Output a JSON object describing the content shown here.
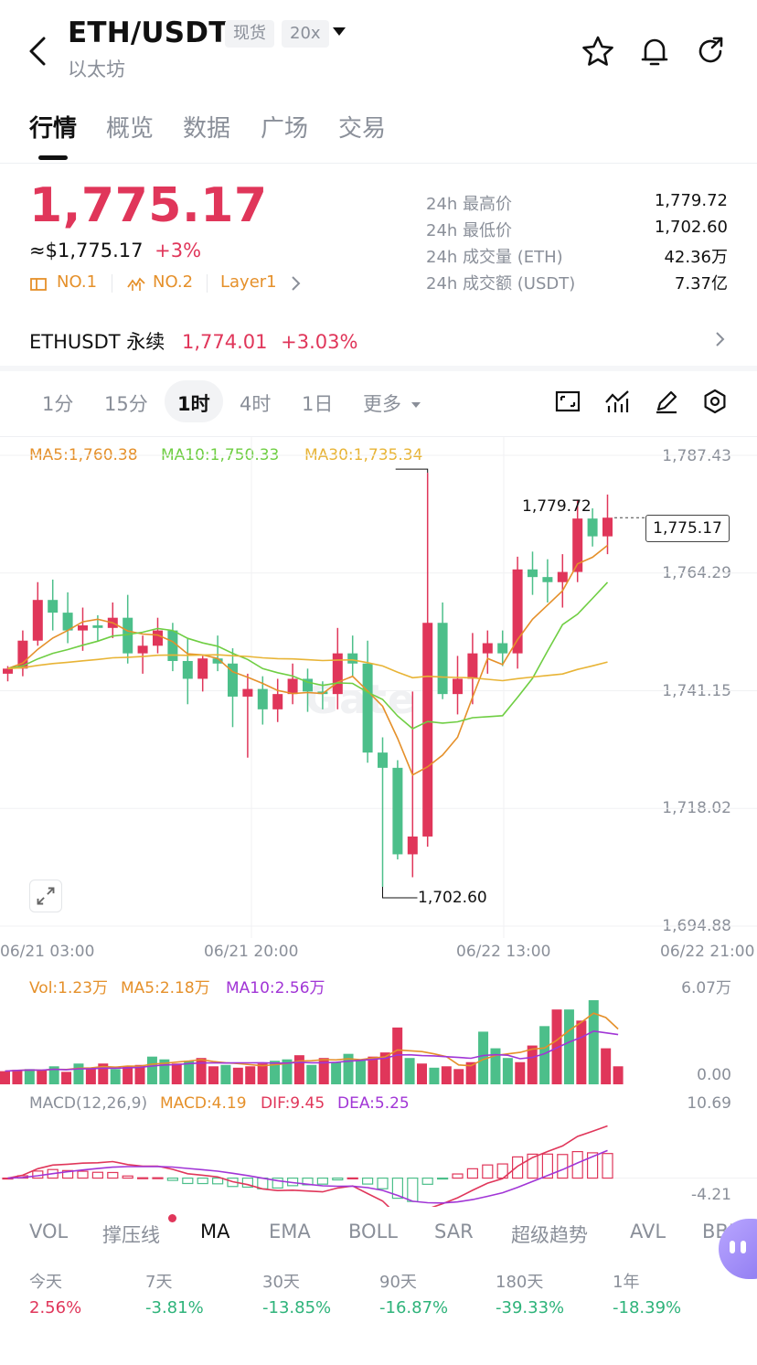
{
  "header": {
    "pair": "ETH/USDT",
    "tag_spot": "现货",
    "tag_leverage": "20x",
    "name": "以太坊",
    "icons": [
      "back-icon",
      "star-icon",
      "bell-icon",
      "share-icon"
    ]
  },
  "tabs": [
    "行情",
    "概览",
    "数据",
    "广场",
    "交易"
  ],
  "price": {
    "last": "1,775.17",
    "usd": "≈$1,775.17",
    "change": "+3%",
    "rank1": "NO.1",
    "rank2": "NO.2",
    "category": "Layer1"
  },
  "stats": [
    {
      "label": "24h 最高价",
      "value": "1,779.72"
    },
    {
      "label": "24h 最低价",
      "value": "1,702.60"
    },
    {
      "label": "24h 成交量 (ETH)",
      "value": "42.36万"
    },
    {
      "label": "24h 成交额 (USDT)",
      "value": "7.37亿"
    }
  ],
  "perp": {
    "name": "ETHUSDT 永续",
    "price": "1,774.01",
    "change": "+3.03%"
  },
  "intervals": [
    "1分",
    "15分",
    "1时",
    "4时",
    "1日",
    "更多"
  ],
  "intervals_active": "1时",
  "chart_tools": [
    "fullscreen-icon",
    "indicator-icon",
    "draw-icon",
    "settings-icon"
  ],
  "ma_legend": {
    "ma5": "MA5:1,760.38",
    "ma10": "MA10:1,750.33",
    "ma30": "MA30:1,735.34"
  },
  "watermark": "Gate",
  "chart_data": {
    "type": "candlestick",
    "y_labels": [
      "1,787.43",
      "1,764.29",
      "1,741.15",
      "1,718.02",
      "1,694.88"
    ],
    "ylim": [
      1694.88,
      1787.43
    ],
    "x_labels": [
      "06/21 03:00",
      "06/21 20:00",
      "06/22 13:00",
      "06/22 21:00"
    ],
    "current_price": "1,775.17",
    "high_annotation": "1,779.72",
    "low_annotation": "1,702.60",
    "candles": [
      [
        1744.5,
        1746.0,
        1743.0,
        1745.5
      ],
      [
        1745.5,
        1753.0,
        1744.0,
        1751.0
      ],
      [
        1751.0,
        1762.5,
        1750.0,
        1759.0
      ],
      [
        1759.0,
        1763.0,
        1753.0,
        1756.5
      ],
      [
        1756.5,
        1760.5,
        1750.5,
        1753.0
      ],
      [
        1753.0,
        1757.5,
        1749.0,
        1754.0
      ],
      [
        1754.0,
        1756.0,
        1751.0,
        1753.5
      ],
      [
        1753.5,
        1758.5,
        1751.5,
        1755.5
      ],
      [
        1755.5,
        1760.0,
        1746.5,
        1748.5
      ],
      [
        1748.5,
        1752.0,
        1744.5,
        1750.0
      ],
      [
        1750.0,
        1755.5,
        1748.5,
        1753.0
      ],
      [
        1753.0,
        1754.5,
        1745.0,
        1747.0
      ],
      [
        1747.0,
        1751.5,
        1738.5,
        1743.5
      ],
      [
        1743.5,
        1748.0,
        1741.0,
        1747.5
      ],
      [
        1747.5,
        1752.0,
        1745.0,
        1746.5
      ],
      [
        1746.5,
        1749.5,
        1734.0,
        1740.0
      ],
      [
        1740.0,
        1744.5,
        1728.0,
        1741.5
      ],
      [
        1741.5,
        1744.0,
        1734.5,
        1737.5
      ],
      [
        1737.5,
        1743.5,
        1735.0,
        1740.5
      ],
      [
        1740.5,
        1746.5,
        1738.5,
        1743.5
      ],
      [
        1743.5,
        1745.5,
        1737.0,
        1741.0
      ],
      [
        1741.0,
        1743.0,
        1737.5,
        1740.5
      ],
      [
        1740.5,
        1753.5,
        1737.5,
        1748.5
      ],
      [
        1748.5,
        1752.0,
        1744.0,
        1746.5
      ],
      [
        1746.5,
        1751.0,
        1727.0,
        1729.0
      ],
      [
        1729.0,
        1732.0,
        1702.6,
        1726.0
      ],
      [
        1726.0,
        1727.5,
        1708.0,
        1709.0
      ],
      [
        1709.0,
        1741.0,
        1704.5,
        1712.5
      ],
      [
        1712.5,
        1784.0,
        1710.5,
        1754.5
      ],
      [
        1754.5,
        1758.5,
        1739.5,
        1740.5
      ],
      [
        1740.5,
        1748.0,
        1736.5,
        1743.5
      ],
      [
        1743.5,
        1752.5,
        1738.5,
        1748.5
      ],
      [
        1748.5,
        1753.0,
        1744.5,
        1750.5
      ],
      [
        1750.5,
        1753.0,
        1746.0,
        1748.5
      ],
      [
        1748.5,
        1767.5,
        1745.5,
        1765.0
      ],
      [
        1765.0,
        1768.5,
        1760.0,
        1763.5
      ],
      [
        1763.5,
        1767.0,
        1758.5,
        1762.5
      ],
      [
        1762.5,
        1768.0,
        1757.5,
        1764.5
      ],
      [
        1764.5,
        1778.5,
        1762.5,
        1775.0
      ],
      [
        1775.0,
        1777.0,
        1769.5,
        1771.5
      ],
      [
        1771.5,
        1779.72,
        1768.0,
        1775.17
      ]
    ],
    "ma_lines": {
      "MA5": "1,760.38",
      "MA10": "1,750.33",
      "MA30": "1,735.34"
    }
  },
  "volume": {
    "legend": {
      "vol": "Vol:1.23万",
      "ma5": "MA5:2.18万",
      "ma10": "MA10:2.56万"
    },
    "y_labels": [
      "6.07万",
      "0.00"
    ],
    "values": [
      0.95,
      1.05,
      1.1,
      1.0,
      1.3,
      0.9,
      1.5,
      1.2,
      1.5,
      1.1,
      1.3,
      1.4,
      2.0,
      1.8,
      1.5,
      1.7,
      1.9,
      1.3,
      1.4,
      1.2,
      1.3,
      1.5,
      1.7,
      1.8,
      2.1,
      1.4,
      1.9,
      1.6,
      2.2,
      1.8,
      2.0,
      2.3,
      4.1,
      1.9,
      1.5,
      1.2,
      1.3,
      1.1,
      1.6,
      3.8,
      2.6,
      1.9,
      1.6,
      2.8,
      4.2,
      5.4,
      5.4,
      4.6,
      6.07,
      2.6,
      1.3
    ]
  },
  "macd": {
    "legend": {
      "name": "MACD(12,26,9)",
      "macd": "MACD:4.19",
      "dif": "DIF:9.45",
      "dea": "DEA:5.25"
    },
    "y_labels": [
      "10.69",
      "-4.21"
    ]
  },
  "indicators": [
    "VOL",
    "撑压线",
    "MA",
    "EMA",
    "BOLL",
    "SAR",
    "超级趋势",
    "AVL",
    "BBI"
  ],
  "indicators_active": "MA",
  "performance": [
    {
      "label": "今天",
      "value": "2.56%",
      "dir": "up"
    },
    {
      "label": "7天",
      "value": "-3.81%",
      "dir": "down"
    },
    {
      "label": "30天",
      "value": "-13.85%",
      "dir": "down"
    },
    {
      "label": "90天",
      "value": "-16.87%",
      "dir": "down"
    },
    {
      "label": "180天",
      "value": "-39.33%",
      "dir": "down"
    },
    {
      "label": "1年",
      "value": "-18.39%",
      "dir": "down"
    }
  ]
}
